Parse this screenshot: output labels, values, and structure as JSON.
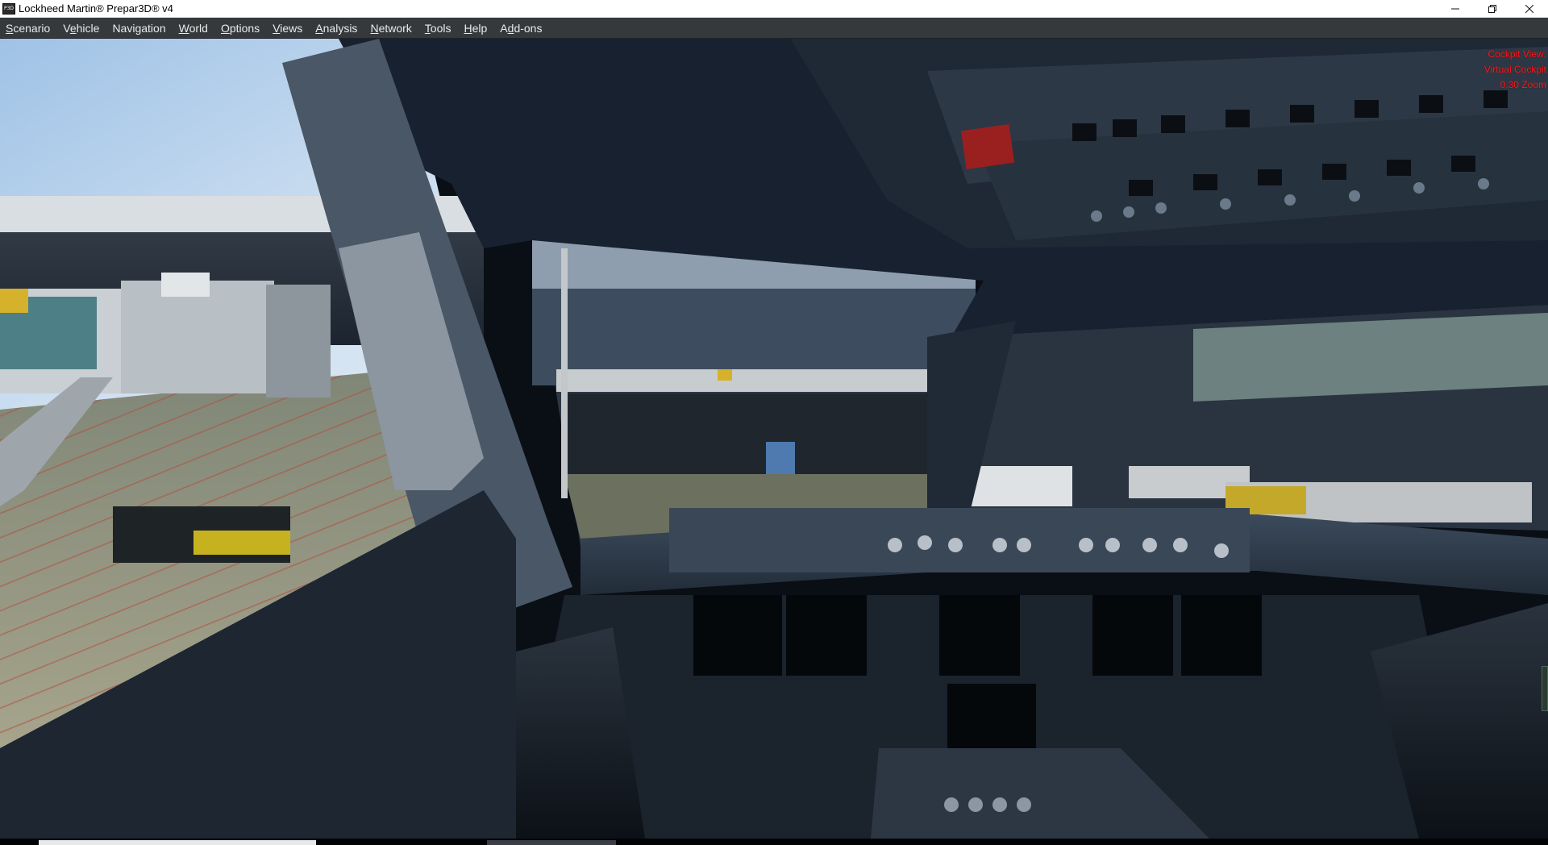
{
  "window": {
    "title": "Lockheed Martin® Prepar3D® v4",
    "icon_name": "prepar3d-app-icon",
    "controls": {
      "minimize": "minimize-icon",
      "restore": "restore-icon",
      "close": "close-icon"
    }
  },
  "menu": {
    "items": [
      {
        "pre": "",
        "acc": "S",
        "post": "cenario"
      },
      {
        "pre": "V",
        "acc": "e",
        "post": "hicle"
      },
      {
        "pre": "Navi",
        "acc": "g",
        "post": "ation"
      },
      {
        "pre": "",
        "acc": "W",
        "post": "orld"
      },
      {
        "pre": "",
        "acc": "O",
        "post": "ptions"
      },
      {
        "pre": "",
        "acc": "V",
        "post": "iews"
      },
      {
        "pre": "",
        "acc": "A",
        "post": "nalysis"
      },
      {
        "pre": "",
        "acc": "N",
        "post": "etwork"
      },
      {
        "pre": "",
        "acc": "T",
        "post": "ools"
      },
      {
        "pre": "",
        "acc": "H",
        "post": "elp"
      },
      {
        "pre": "A",
        "acc": "d",
        "post": "d-ons"
      }
    ]
  },
  "hud": {
    "line1": "Cockpit View:",
    "line2": "Virtual Cockpit",
    "line3": "0.30 Zoom",
    "color": "#ff1a1a"
  },
  "scene": {
    "description_icon": "cockpit-3d-view"
  }
}
